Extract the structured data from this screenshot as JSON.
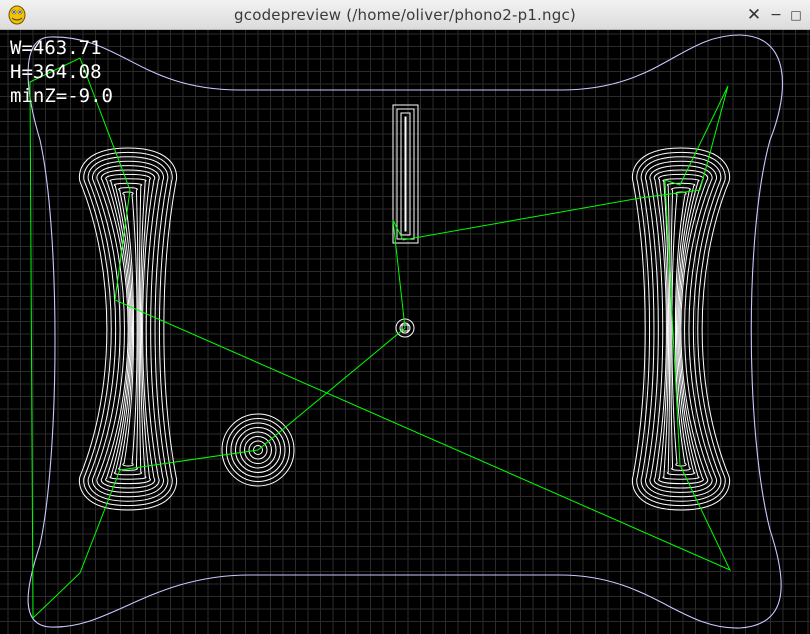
{
  "window": {
    "title": "gcodepreview (/home/oliver/phono2-p1.ngc)",
    "app_icon": "python-snake-icon",
    "controls": {
      "close_glyph": "✕",
      "minimize_glyph": "−",
      "maximize_glyph": "□"
    }
  },
  "readout": {
    "width": "W=463.71",
    "height": "H=364.08",
    "min_z": "minZ=-9.0"
  },
  "colors": {
    "background": "#000000",
    "grid": "#2a2a2a",
    "toolpath_cut": "#ffffff",
    "outline": "#c8c8ff",
    "rapid_move": "#00ff00",
    "readout_text": "#ffffff"
  }
}
